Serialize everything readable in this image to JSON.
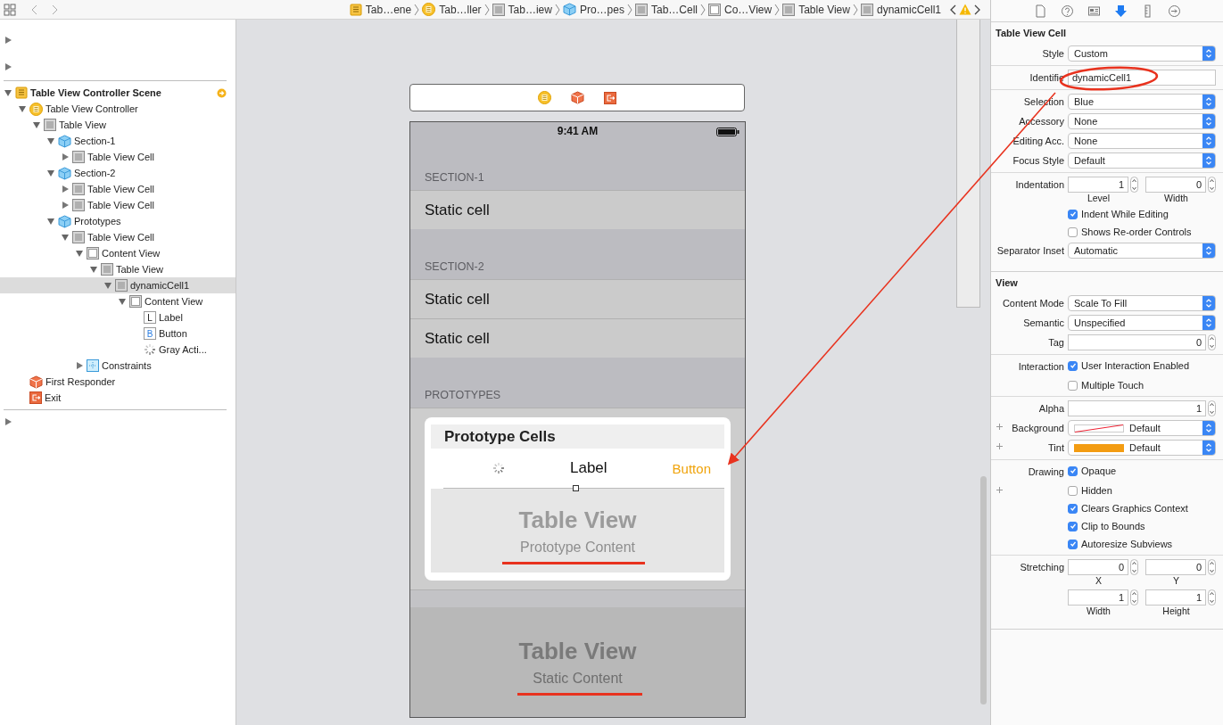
{
  "toolbar": {
    "breadcrumb": [
      {
        "label": "Tab…ene",
        "kind": "scene"
      },
      {
        "label": "Tab…ller",
        "kind": "controller"
      },
      {
        "label": "Tab…iew",
        "kind": "table"
      },
      {
        "label": "Pro…pes",
        "kind": "section"
      },
      {
        "label": "Tab…Cell",
        "kind": "cell"
      },
      {
        "label": "Co…View",
        "kind": "view"
      },
      {
        "label": "Table View",
        "kind": "table"
      },
      {
        "label": "dynamicCell1",
        "kind": "cell"
      }
    ]
  },
  "outline": {
    "tree": [
      {
        "label": "Table View Controller Scene",
        "kind": "scene",
        "expanded": true,
        "selected": false,
        "children": [
          {
            "label": "Table View Controller",
            "kind": "controller",
            "expanded": true,
            "selected": false,
            "children": [
              {
                "label": "Table View",
                "kind": "table",
                "expanded": true,
                "selected": false,
                "children": [
                  {
                    "label": "Section-1",
                    "kind": "section",
                    "expanded": true,
                    "selected": false,
                    "children": [
                      {
                        "label": "Table View Cell",
                        "kind": "cell",
                        "expanded": false,
                        "selected": false
                      }
                    ]
                  },
                  {
                    "label": "Section-2",
                    "kind": "section",
                    "expanded": true,
                    "selected": false,
                    "children": [
                      {
                        "label": "Table View Cell",
                        "kind": "cell",
                        "expanded": false,
                        "selected": false
                      },
                      {
                        "label": "Table View Cell",
                        "kind": "cell",
                        "expanded": false,
                        "selected": false
                      }
                    ]
                  },
                  {
                    "label": "Prototypes",
                    "kind": "section",
                    "expanded": true,
                    "selected": false,
                    "children": [
                      {
                        "label": "Table View Cell",
                        "kind": "cell",
                        "expanded": true,
                        "selected": false,
                        "children": [
                          {
                            "label": "Content View",
                            "kind": "view",
                            "expanded": true,
                            "selected": false,
                            "children": [
                              {
                                "label": "Table View",
                                "kind": "table",
                                "expanded": true,
                                "selected": false,
                                "children": [
                                  {
                                    "label": "dynamicCell1",
                                    "kind": "cell",
                                    "expanded": true,
                                    "selected": true,
                                    "children": [
                                      {
                                        "label": "Content View",
                                        "kind": "view",
                                        "expanded": true,
                                        "selected": false,
                                        "children": [
                                          {
                                            "label": "Label",
                                            "kind": "label",
                                            "badge": "L",
                                            "selected": false
                                          },
                                          {
                                            "label": "Button",
                                            "kind": "button",
                                            "badge": "B",
                                            "selected": false
                                          },
                                          {
                                            "label": "Gray Acti...",
                                            "kind": "activity",
                                            "selected": false
                                          }
                                        ]
                                      }
                                    ]
                                  }
                                ]
                              }
                            ]
                          },
                          {
                            "label": "Constraints",
                            "kind": "constraints",
                            "expanded": false,
                            "selected": false
                          }
                        ]
                      }
                    ]
                  }
                ]
              }
            ]
          },
          {
            "label": "First Responder",
            "kind": "responder",
            "selected": false
          },
          {
            "label": "Exit",
            "kind": "exit",
            "selected": false
          }
        ]
      }
    ]
  },
  "canvas": {
    "phone": {
      "time": "9:41 AM",
      "sections": [
        {
          "header": "SECTION-1",
          "cells": [
            "Static cell"
          ]
        },
        {
          "header": "SECTION-2",
          "cells": [
            "Static cell",
            "Static cell"
          ]
        }
      ],
      "prototypes": {
        "header": "PROTOTYPES",
        "title": "Prototype Cells",
        "label": "Label",
        "button": "Button",
        "placeholder_title": "Table View",
        "placeholder_subtitle": "Prototype Content"
      },
      "static": {
        "title": "Table View",
        "subtitle": "Static Content"
      }
    }
  },
  "inspector": {
    "tabs": [
      {
        "kind": "file",
        "selected": false
      },
      {
        "kind": "help",
        "selected": false
      },
      {
        "kind": "identity",
        "selected": false
      },
      {
        "kind": "attributes",
        "selected": true
      },
      {
        "kind": "size",
        "selected": false
      },
      {
        "kind": "connections",
        "selected": false
      }
    ],
    "sections": [
      {
        "title": "Table View Cell",
        "groups": [
          {
            "rows": [
              {
                "kind": "select",
                "label": "Style",
                "value": "Custom"
              }
            ]
          },
          {
            "rows": [
              {
                "kind": "text",
                "label": "Identifie",
                "value": "dynamicCell1"
              }
            ]
          },
          {
            "rows": [
              {
                "kind": "select",
                "label": "Selection",
                "value": "Blue"
              },
              {
                "kind": "select",
                "label": "Accessory",
                "value": "None"
              },
              {
                "kind": "select",
                "label": "Editing Acc.",
                "value": "None"
              },
              {
                "kind": "select",
                "label": "Focus Style",
                "value": "Default"
              }
            ]
          },
          {
            "rows": [
              {
                "kind": "pair",
                "label": "Indentation",
                "fields": [
                  {
                    "value": "1",
                    "caption": "Level"
                  },
                  {
                    "value": "0",
                    "caption": "Width"
                  }
                ]
              },
              {
                "kind": "checkbox",
                "text": "Indent While Editing",
                "checked": true
              },
              {
                "kind": "checkbox",
                "text": "Shows Re-order Controls",
                "checked": false
              },
              {
                "kind": "select",
                "label": "Separator Inset",
                "value": "Automatic"
              }
            ]
          }
        ]
      },
      {
        "title": "View",
        "groups": [
          {
            "rows": [
              {
                "kind": "select",
                "label": "Content Mode",
                "value": "Scale To Fill"
              },
              {
                "kind": "select",
                "label": "Semantic",
                "value": "Unspecified"
              },
              {
                "kind": "number",
                "label": "Tag",
                "value": "0"
              }
            ]
          },
          {
            "rows": [
              {
                "kind": "checkbox",
                "label": "Interaction",
                "text": "User Interaction Enabled",
                "checked": true
              },
              {
                "kind": "checkbox",
                "text": "Multiple Touch",
                "checked": false
              }
            ]
          },
          {
            "rows": [
              {
                "kind": "number",
                "label": "Alpha",
                "value": "1"
              },
              {
                "kind": "select",
                "label": "Background",
                "value": "Default",
                "plus": true,
                "swatch": {
                  "kind": "clear"
                }
              },
              {
                "kind": "select",
                "label": "Tint",
                "value": "Default",
                "plus": true,
                "swatch": {
                  "kind": "fill",
                  "color": "#f39c12"
                }
              }
            ]
          },
          {
            "rows": [
              {
                "kind": "checkbox",
                "label": "Drawing",
                "text": "Opaque",
                "checked": true
              },
              {
                "kind": "checkbox",
                "text": "Hidden",
                "checked": false,
                "plus": true
              },
              {
                "kind": "checkbox",
                "text": "Clears Graphics Context",
                "checked": true
              },
              {
                "kind": "checkbox",
                "text": "Clip to Bounds",
                "checked": true
              },
              {
                "kind": "checkbox",
                "text": "Autoresize Subviews",
                "checked": true
              }
            ]
          },
          {
            "rows": [
              {
                "kind": "pair",
                "label": "Stretching",
                "fields": [
                  {
                    "value": "0",
                    "caption": "X"
                  },
                  {
                    "value": "0",
                    "caption": "Y"
                  }
                ]
              },
              {
                "kind": "pair",
                "fields": [
                  {
                    "value": "1",
                    "caption": "Width"
                  },
                  {
                    "value": "1",
                    "caption": "Height"
                  }
                ]
              }
            ]
          }
        ]
      }
    ]
  }
}
